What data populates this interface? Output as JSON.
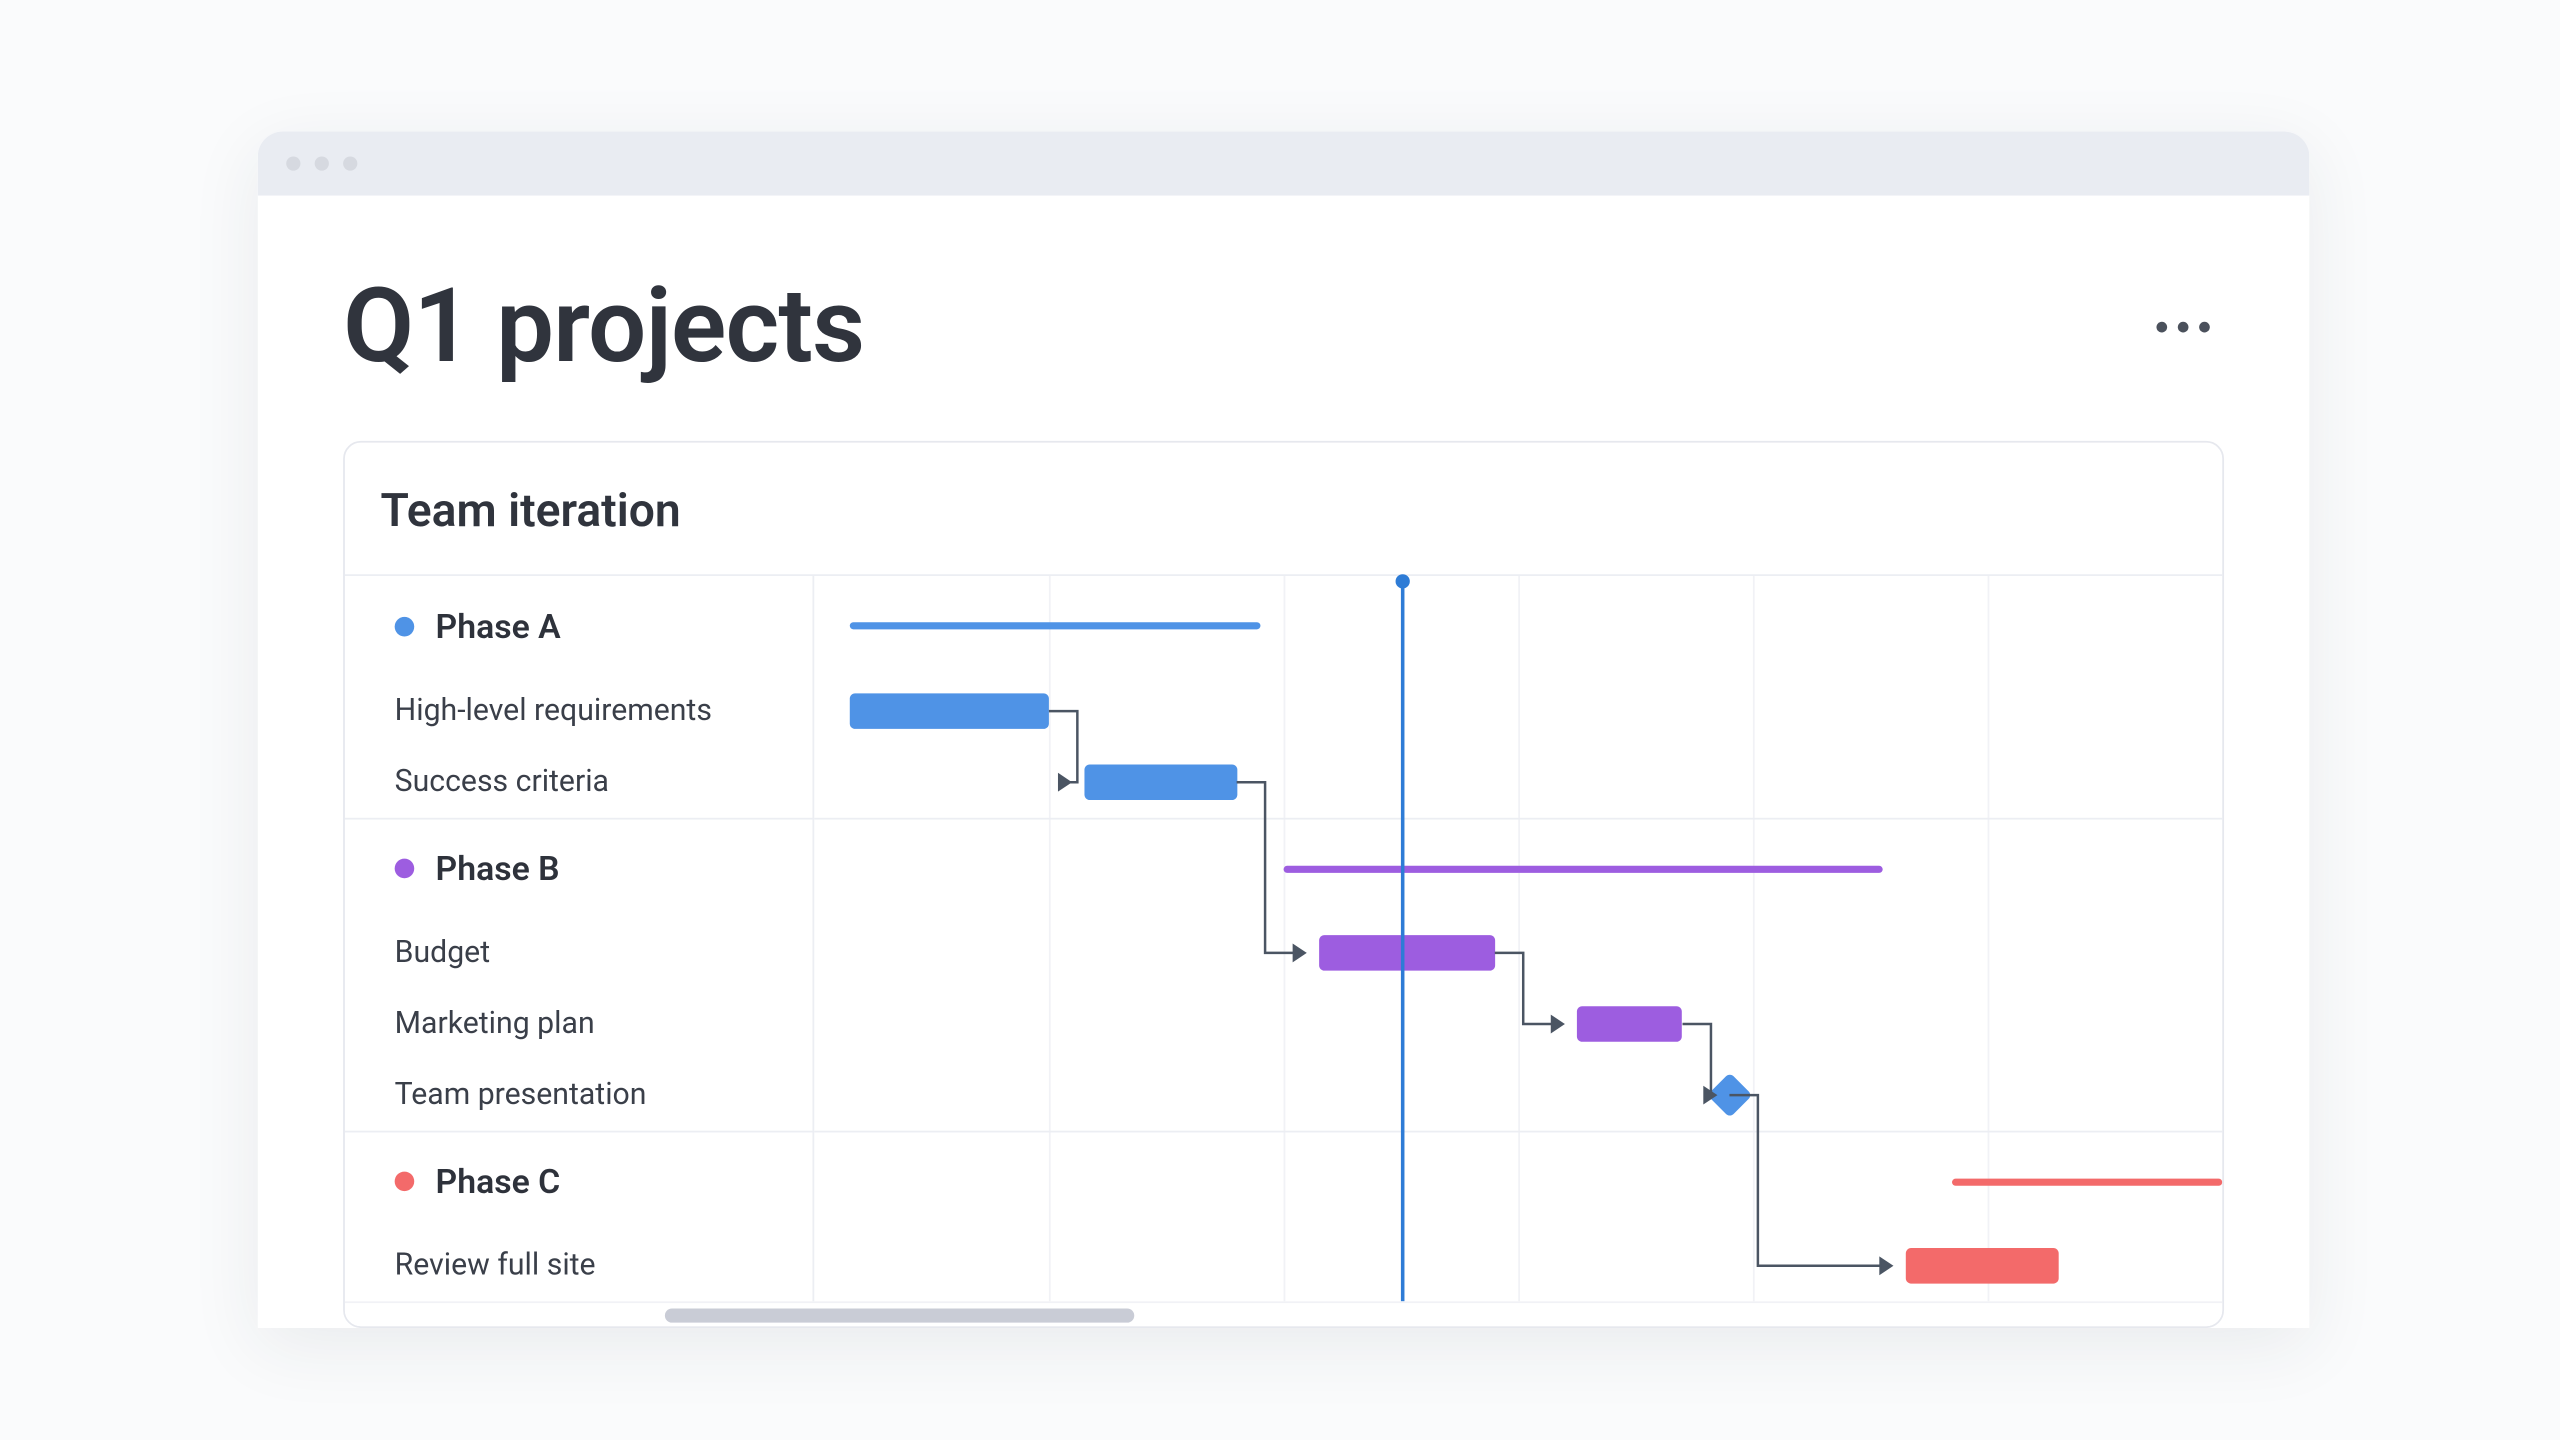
{
  "header": {
    "title": "Q1 projects"
  },
  "card": {
    "title": "Team iteration"
  },
  "colors": {
    "phase_a": "#4f93e6",
    "phase_b": "#9d5de0",
    "phase_c": "#f36a6a",
    "milestone": "#4f93e6",
    "now_line": "#2e7cd6"
  },
  "chart_data": {
    "type": "gantt",
    "time_axis": {
      "start": 0,
      "end": 6,
      "grid_step": 1,
      "now": 2.5
    },
    "groups": [
      {
        "name": "Phase A",
        "color": "phase_a",
        "span": {
          "start": 0.15,
          "end": 1.9
        },
        "tasks": [
          {
            "name": "High-level requirements",
            "start": 0.15,
            "end": 1.0
          },
          {
            "name": "Success criteria",
            "start": 1.15,
            "end": 1.8
          }
        ]
      },
      {
        "name": "Phase B",
        "color": "phase_b",
        "span": {
          "start": 2.0,
          "end": 4.55
        },
        "tasks": [
          {
            "name": "Budget",
            "start": 2.15,
            "end": 2.9
          },
          {
            "name": "Marketing plan",
            "start": 3.25,
            "end": 3.7
          },
          {
            "name": "Team presentation",
            "milestone": true,
            "at": 3.9
          }
        ]
      },
      {
        "name": "Phase C",
        "color": "phase_c",
        "span": {
          "start": 4.85,
          "end": 6.0
        },
        "tasks": [
          {
            "name": "Review full site",
            "start": 4.65,
            "end": 5.3
          }
        ]
      }
    ],
    "dependencies": [
      {
        "from": "High-level requirements",
        "to": "Success criteria"
      },
      {
        "from": "Success criteria",
        "to": "Budget"
      },
      {
        "from": "Budget",
        "to": "Marketing plan"
      },
      {
        "from": "Marketing plan",
        "to": "Team presentation"
      },
      {
        "from": "Team presentation",
        "to": "Review full site"
      }
    ]
  },
  "scrollbar": {
    "thumb_start": 0.17,
    "thumb_end": 0.42
  }
}
